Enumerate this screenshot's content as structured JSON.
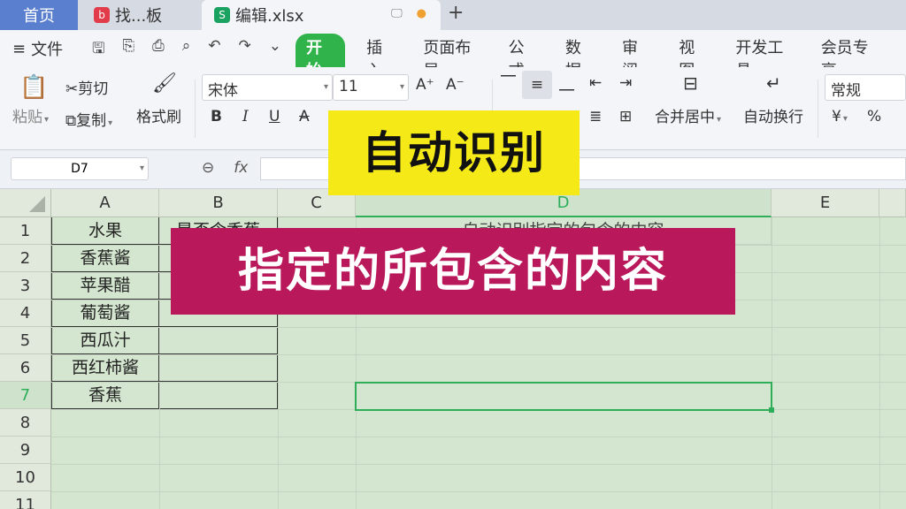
{
  "tabs": {
    "home": "首页",
    "find": "找...板",
    "edit": "编辑.xlsx"
  },
  "menu": {
    "file": "文件",
    "items": [
      "开始",
      "插入",
      "页面布局",
      "公式",
      "数据",
      "审阅",
      "视图",
      "开发工具",
      "会员专享"
    ]
  },
  "ribbon": {
    "paste": "粘贴",
    "cut": "剪切",
    "copy": "复制",
    "format_painter": "格式刷",
    "font": "宋体",
    "size": "11",
    "bold": "B",
    "italic": "I",
    "underline": "U",
    "merge": "合并居中",
    "wrap": "自动换行",
    "number_format": "常规",
    "currency": "¥",
    "percent": "%"
  },
  "formula_bar": {
    "name_box": "D7",
    "fx": "fx"
  },
  "columns": [
    "A",
    "B",
    "C",
    "D",
    "E"
  ],
  "rows": [
    "1",
    "2",
    "3",
    "4",
    "5",
    "6",
    "7",
    "8",
    "9",
    "10",
    "11"
  ],
  "cells": {
    "A": [
      "水果",
      "香蕉酱",
      "苹果醋",
      "葡萄酱",
      "西瓜汁",
      "西红柿酱",
      "香蕉"
    ],
    "B1": "是否含香蕉",
    "D1": "自动识别指定的包含的内容"
  },
  "overlays": {
    "yellow": "自动识别",
    "red": "指定的所包含的内容"
  }
}
